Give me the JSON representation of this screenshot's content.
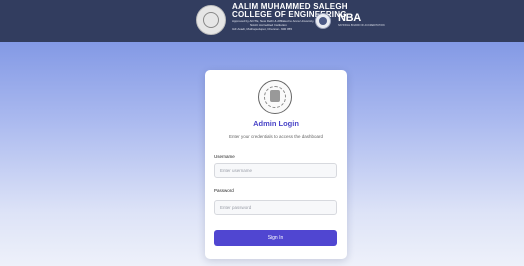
{
  "header": {
    "college_name_line1": "AALIM MUHAMMED SALEGH",
    "college_name_line2": "COLLEGE OF ENGINEERING",
    "college_line_a": "Approved by AICTE, New Delhi & Affiliated to Anna University, Chennai",
    "college_line_b": "NAAC Accredited Institution",
    "college_line_c": "IAF Avadi, Muthapudupet, Chennai - 600 055",
    "nba_text": "NBA",
    "nba_sub": "NATIONAL BOARD OF ACCREDITATION"
  },
  "login": {
    "title": "Admin Login",
    "subtitle": "Enter your credentials to access the dashboard",
    "username_label": "Username",
    "username_placeholder": "Enter username",
    "password_label": "Password",
    "password_placeholder": "Enter password",
    "submit_label": "Sign In"
  },
  "colors": {
    "header_bg": "#323d5f",
    "accent": "#5046d1",
    "title": "#4a45c8"
  }
}
